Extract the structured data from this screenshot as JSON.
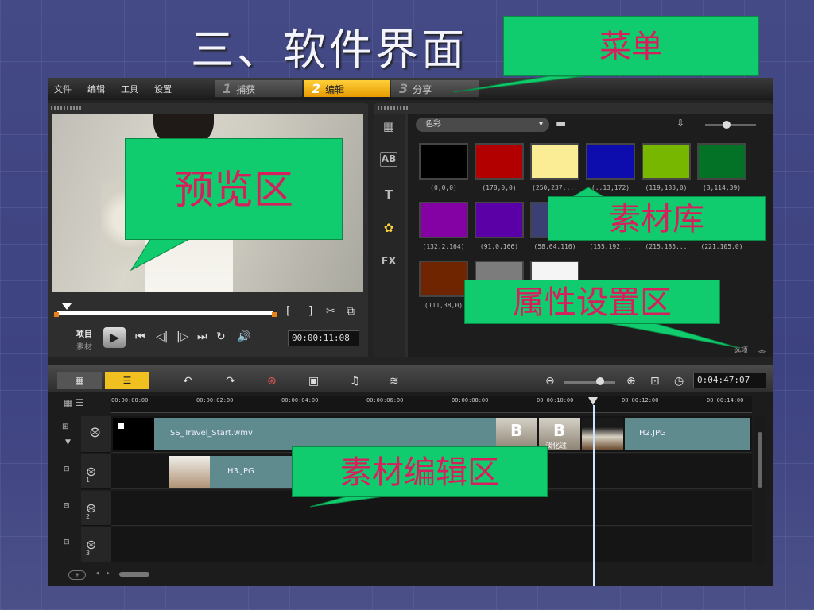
{
  "slide": {
    "title": "三、软件界面"
  },
  "menu": [
    "文件",
    "编辑",
    "工具",
    "设置"
  ],
  "steps": [
    {
      "num": "1",
      "label": "捕获"
    },
    {
      "num": "2",
      "label": "编辑"
    },
    {
      "num": "3",
      "label": "分享"
    }
  ],
  "preview": {
    "mode_project": "项目",
    "mode_clip": "素材",
    "timecode": "00:00:11:08"
  },
  "library": {
    "category": "色彩",
    "swatches": [
      {
        "color": "#000000",
        "label": "(0,0,0)"
      },
      {
        "color": "#b20000",
        "label": "(178,0,0)"
      },
      {
        "color": "#faed96",
        "label": "(250,237,..."
      },
      {
        "color": "#0d0cac",
        "label": "(..13,172)"
      },
      {
        "color": "#77b700",
        "label": "(119,183,0)"
      },
      {
        "color": "#037227",
        "label": "(3,114,39)"
      },
      {
        "color": "#8402a4",
        "label": "(132,2,164)"
      },
      {
        "color": "#5b00a6",
        "label": "(91,0,166)"
      },
      {
        "color": "#3a4074",
        "label": "(58,64,116)"
      },
      {
        "color": "#9bc0e0",
        "label": "(155,192..."
      },
      {
        "color": "#d7b98a",
        "label": "(215,185..."
      },
      {
        "color": "#dd6900",
        "label": "(221,105,0)"
      },
      {
        "color": "#6f2600",
        "label": "(111,38,0)"
      },
      {
        "color": "#7c7c7c",
        "label": ""
      },
      {
        "color": "#f5f5f5",
        "label": ""
      }
    ],
    "options_label": "选项"
  },
  "timeline": {
    "duration": "0:04:47:07",
    "ticks": [
      "00:00:00:00",
      "00:00:02:00",
      "00:00:04:00",
      "00:00:06:00",
      "00:00:08:00",
      "00:00:10:00",
      "00:00:12:00",
      "00:00:14:00"
    ],
    "video_clip": "SS_Travel_Start.wmv",
    "transition_label": "淡化过",
    "clip_h2": "H2.JPG",
    "overlay_clip": "H3.JPG",
    "track_numbers": [
      "1",
      "2",
      "3"
    ]
  },
  "callouts": {
    "menu": "菜单",
    "preview": "预览区",
    "library": "素材库",
    "properties": "属性设置区",
    "editing": "素材编辑区"
  }
}
